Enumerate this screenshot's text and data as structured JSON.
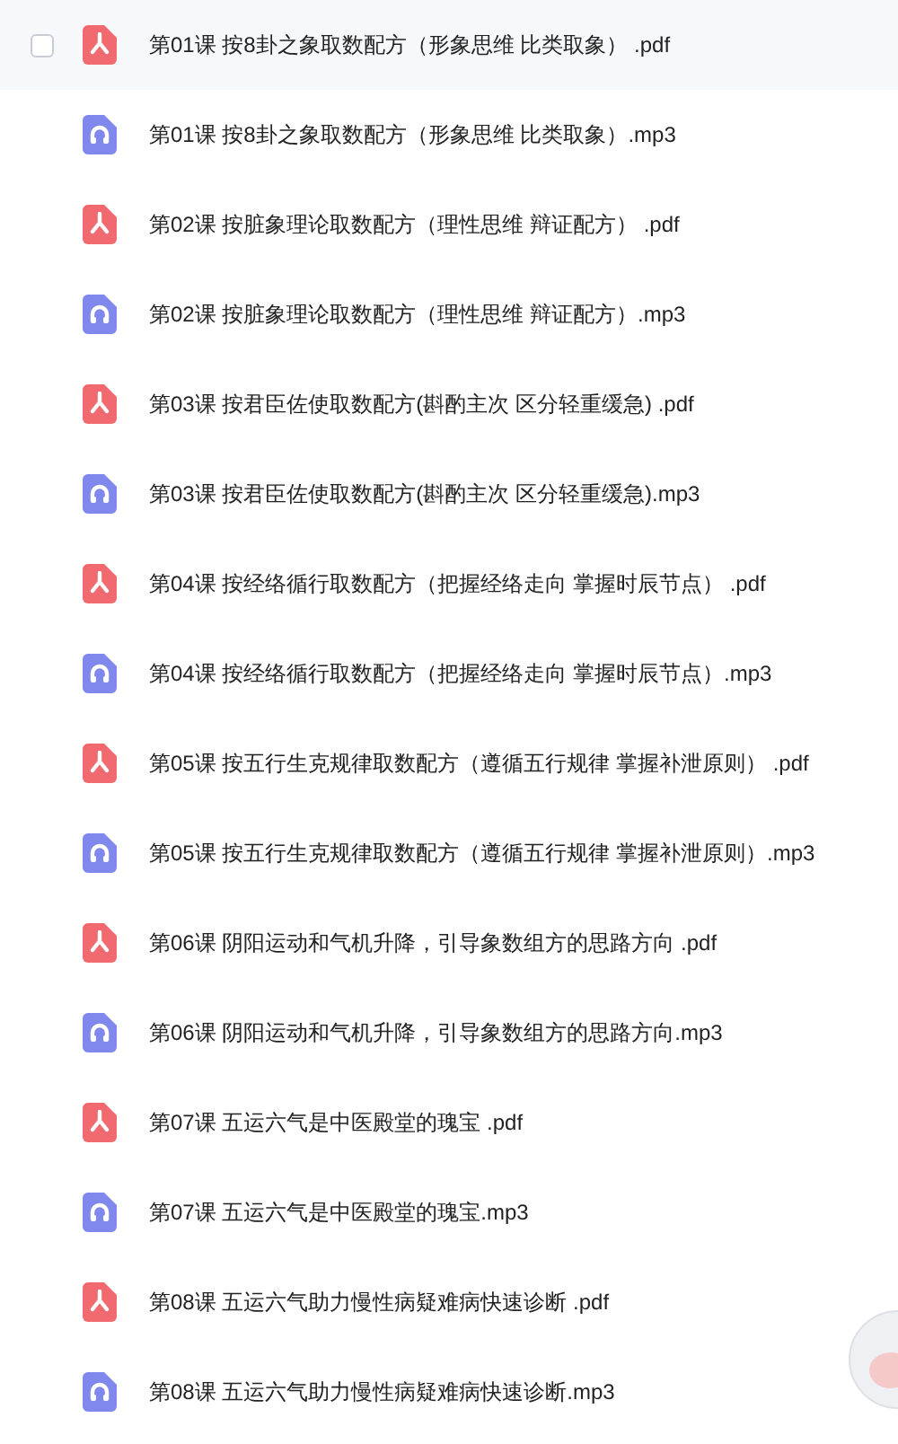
{
  "files": [
    {
      "kind": "pdf",
      "name": "第01课 按8卦之象取数配方（形象思维 比类取象） .pdf",
      "hovered": true
    },
    {
      "kind": "audio",
      "name": "第01课 按8卦之象取数配方（形象思维 比类取象）.mp3",
      "hovered": false
    },
    {
      "kind": "pdf",
      "name": "第02课 按脏象理论取数配方（理性思维 辩证配方） .pdf",
      "hovered": false
    },
    {
      "kind": "audio",
      "name": "第02课 按脏象理论取数配方（理性思维 辩证配方）.mp3",
      "hovered": false
    },
    {
      "kind": "pdf",
      "name": "第03课 按君臣佐使取数配方(斟酌主次 区分轻重缓急) .pdf",
      "hovered": false
    },
    {
      "kind": "audio",
      "name": "第03课 按君臣佐使取数配方(斟酌主次 区分轻重缓急).mp3",
      "hovered": false
    },
    {
      "kind": "pdf",
      "name": "第04课 按经络循行取数配方（把握经络走向 掌握时辰节点） .pdf",
      "hovered": false
    },
    {
      "kind": "audio",
      "name": "第04课 按经络循行取数配方（把握经络走向 掌握时辰节点）.mp3",
      "hovered": false
    },
    {
      "kind": "pdf",
      "name": "第05课 按五行生克规律取数配方（遵循五行规律 掌握补泄原则） .pdf",
      "hovered": false
    },
    {
      "kind": "audio",
      "name": "第05课 按五行生克规律取数配方（遵循五行规律 掌握补泄原则）.mp3",
      "hovered": false
    },
    {
      "kind": "pdf",
      "name": "第06课 阴阳运动和气机升降，引导象数组方的思路方向 .pdf",
      "hovered": false
    },
    {
      "kind": "audio",
      "name": "第06课 阴阳运动和气机升降，引导象数组方的思路方向.mp3",
      "hovered": false
    },
    {
      "kind": "pdf",
      "name": "第07课 五运六气是中医殿堂的瑰宝 .pdf",
      "hovered": false
    },
    {
      "kind": "audio",
      "name": "第07课 五运六气是中医殿堂的瑰宝.mp3",
      "hovered": false
    },
    {
      "kind": "pdf",
      "name": "第08课 五运六气助力慢性病疑难病快速诊断 .pdf",
      "hovered": false
    },
    {
      "kind": "audio",
      "name": "第08课 五运六气助力慢性病疑难病快速诊断.mp3",
      "hovered": false
    }
  ]
}
